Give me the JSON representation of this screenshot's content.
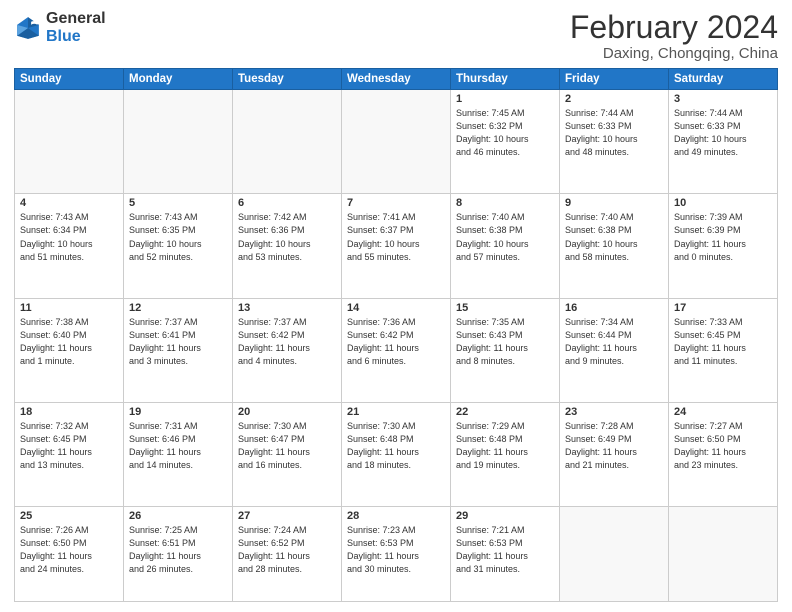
{
  "logo": {
    "general": "General",
    "blue": "Blue"
  },
  "title": "February 2024",
  "location": "Daxing, Chongqing, China",
  "days_header": [
    "Sunday",
    "Monday",
    "Tuesday",
    "Wednesday",
    "Thursday",
    "Friday",
    "Saturday"
  ],
  "weeks": [
    [
      {
        "day": "",
        "info": ""
      },
      {
        "day": "",
        "info": ""
      },
      {
        "day": "",
        "info": ""
      },
      {
        "day": "",
        "info": ""
      },
      {
        "day": "1",
        "info": "Sunrise: 7:45 AM\nSunset: 6:32 PM\nDaylight: 10 hours\nand 46 minutes."
      },
      {
        "day": "2",
        "info": "Sunrise: 7:44 AM\nSunset: 6:33 PM\nDaylight: 10 hours\nand 48 minutes."
      },
      {
        "day": "3",
        "info": "Sunrise: 7:44 AM\nSunset: 6:33 PM\nDaylight: 10 hours\nand 49 minutes."
      }
    ],
    [
      {
        "day": "4",
        "info": "Sunrise: 7:43 AM\nSunset: 6:34 PM\nDaylight: 10 hours\nand 51 minutes."
      },
      {
        "day": "5",
        "info": "Sunrise: 7:43 AM\nSunset: 6:35 PM\nDaylight: 10 hours\nand 52 minutes."
      },
      {
        "day": "6",
        "info": "Sunrise: 7:42 AM\nSunset: 6:36 PM\nDaylight: 10 hours\nand 53 minutes."
      },
      {
        "day": "7",
        "info": "Sunrise: 7:41 AM\nSunset: 6:37 PM\nDaylight: 10 hours\nand 55 minutes."
      },
      {
        "day": "8",
        "info": "Sunrise: 7:40 AM\nSunset: 6:38 PM\nDaylight: 10 hours\nand 57 minutes."
      },
      {
        "day": "9",
        "info": "Sunrise: 7:40 AM\nSunset: 6:38 PM\nDaylight: 10 hours\nand 58 minutes."
      },
      {
        "day": "10",
        "info": "Sunrise: 7:39 AM\nSunset: 6:39 PM\nDaylight: 11 hours\nand 0 minutes."
      }
    ],
    [
      {
        "day": "11",
        "info": "Sunrise: 7:38 AM\nSunset: 6:40 PM\nDaylight: 11 hours\nand 1 minute."
      },
      {
        "day": "12",
        "info": "Sunrise: 7:37 AM\nSunset: 6:41 PM\nDaylight: 11 hours\nand 3 minutes."
      },
      {
        "day": "13",
        "info": "Sunrise: 7:37 AM\nSunset: 6:42 PM\nDaylight: 11 hours\nand 4 minutes."
      },
      {
        "day": "14",
        "info": "Sunrise: 7:36 AM\nSunset: 6:42 PM\nDaylight: 11 hours\nand 6 minutes."
      },
      {
        "day": "15",
        "info": "Sunrise: 7:35 AM\nSunset: 6:43 PM\nDaylight: 11 hours\nand 8 minutes."
      },
      {
        "day": "16",
        "info": "Sunrise: 7:34 AM\nSunset: 6:44 PM\nDaylight: 11 hours\nand 9 minutes."
      },
      {
        "day": "17",
        "info": "Sunrise: 7:33 AM\nSunset: 6:45 PM\nDaylight: 11 hours\nand 11 minutes."
      }
    ],
    [
      {
        "day": "18",
        "info": "Sunrise: 7:32 AM\nSunset: 6:45 PM\nDaylight: 11 hours\nand 13 minutes."
      },
      {
        "day": "19",
        "info": "Sunrise: 7:31 AM\nSunset: 6:46 PM\nDaylight: 11 hours\nand 14 minutes."
      },
      {
        "day": "20",
        "info": "Sunrise: 7:30 AM\nSunset: 6:47 PM\nDaylight: 11 hours\nand 16 minutes."
      },
      {
        "day": "21",
        "info": "Sunrise: 7:30 AM\nSunset: 6:48 PM\nDaylight: 11 hours\nand 18 minutes."
      },
      {
        "day": "22",
        "info": "Sunrise: 7:29 AM\nSunset: 6:48 PM\nDaylight: 11 hours\nand 19 minutes."
      },
      {
        "day": "23",
        "info": "Sunrise: 7:28 AM\nSunset: 6:49 PM\nDaylight: 11 hours\nand 21 minutes."
      },
      {
        "day": "24",
        "info": "Sunrise: 7:27 AM\nSunset: 6:50 PM\nDaylight: 11 hours\nand 23 minutes."
      }
    ],
    [
      {
        "day": "25",
        "info": "Sunrise: 7:26 AM\nSunset: 6:50 PM\nDaylight: 11 hours\nand 24 minutes."
      },
      {
        "day": "26",
        "info": "Sunrise: 7:25 AM\nSunset: 6:51 PM\nDaylight: 11 hours\nand 26 minutes."
      },
      {
        "day": "27",
        "info": "Sunrise: 7:24 AM\nSunset: 6:52 PM\nDaylight: 11 hours\nand 28 minutes."
      },
      {
        "day": "28",
        "info": "Sunrise: 7:23 AM\nSunset: 6:53 PM\nDaylight: 11 hours\nand 30 minutes."
      },
      {
        "day": "29",
        "info": "Sunrise: 7:21 AM\nSunset: 6:53 PM\nDaylight: 11 hours\nand 31 minutes."
      },
      {
        "day": "",
        "info": ""
      },
      {
        "day": "",
        "info": ""
      }
    ]
  ]
}
